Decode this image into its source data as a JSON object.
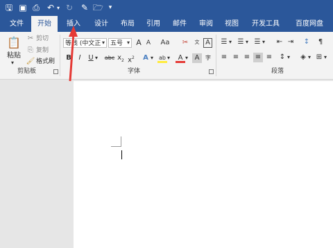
{
  "app": {
    "accent": "#2b579a",
    "arrow_color": "#e53935"
  },
  "quick_access": {
    "icons": [
      "save-icon",
      "print-preview-icon",
      "print-icon",
      "undo-icon",
      "redo-icon",
      "edit-icon",
      "open-folder-icon",
      "customize-icon"
    ]
  },
  "tabs": [
    {
      "label": "文件",
      "active": false
    },
    {
      "label": "开始",
      "active": true
    },
    {
      "label": "插入",
      "active": false
    },
    {
      "label": "设计",
      "active": false
    },
    {
      "label": "布局",
      "active": false
    },
    {
      "label": "引用",
      "active": false
    },
    {
      "label": "邮件",
      "active": false
    },
    {
      "label": "审阅",
      "active": false
    },
    {
      "label": "视图",
      "active": false
    },
    {
      "label": "开发工具",
      "active": false
    },
    {
      "label": "百度网盘",
      "active": false
    }
  ],
  "clipboard": {
    "paste_label": "粘贴",
    "cut_label": "剪切",
    "copy_label": "复制",
    "format_painter_label": "格式刷",
    "group_label": "剪贴板"
  },
  "font": {
    "font_name": "等线 (中文正",
    "font_size": "五号",
    "grow": "A",
    "shrink": "A",
    "change_case": "Aa",
    "bold": "B",
    "italic": "I",
    "underline": "U",
    "strike": "abc",
    "subscript": "x",
    "superscript": "x",
    "group_label": "字体"
  },
  "paragraph": {
    "group_label": "段落"
  }
}
